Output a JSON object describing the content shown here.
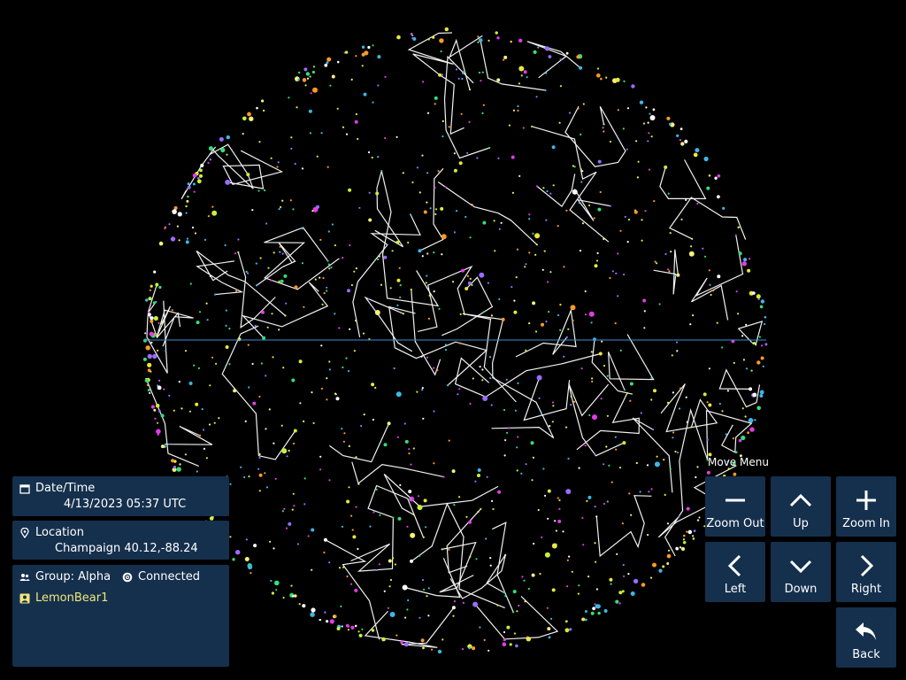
{
  "datetime": {
    "label": "Date/Time",
    "value": "4/13/2023 05:37 UTC"
  },
  "location": {
    "label": "Location",
    "value": "Champaign 40.12,-88.24"
  },
  "group": {
    "label": "Group: Alpha",
    "status": "Connected",
    "user": "LemonBear1"
  },
  "move_menu": {
    "title": "Move Menu",
    "zoom_out": "Zoom Out",
    "up": "Up",
    "zoom_in": "Zoom In",
    "left": "Left",
    "down": "Down",
    "right": "Right",
    "back": "Back"
  },
  "icons": {
    "datetime": "calendar-icon",
    "location": "location-pin-icon",
    "group": "group-icon",
    "status": "connected-icon",
    "user": "user-badge-icon"
  },
  "colors": {
    "panel": "#15304d",
    "user_name": "#f2e67a",
    "horizon": "#3a8fd6"
  }
}
